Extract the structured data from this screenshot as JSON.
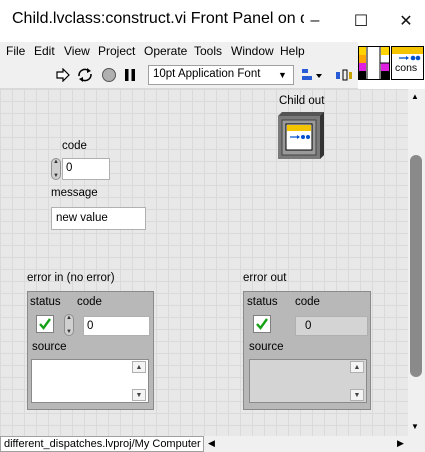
{
  "window": {
    "title": "Child.lvclass:construct.vi Front Panel on di···",
    "minimize": "–",
    "maximize": "☐",
    "close": "✕"
  },
  "menu": [
    "File",
    "Edit",
    "View",
    "Project",
    "Operate",
    "Tools",
    "Window",
    "Help"
  ],
  "toolbar": {
    "font": "10pt Application Font"
  },
  "icon": {
    "label": "cons"
  },
  "controls": {
    "child_out_label": "Child out",
    "code_label": "code",
    "code_value": "0",
    "message_label": "message",
    "message_value": "new value",
    "error_in": {
      "label": "error in (no error)",
      "status_label": "status",
      "code_label": "code",
      "code_value": "0",
      "source_label": "source"
    },
    "error_out": {
      "label": "error out",
      "status_label": "status",
      "code_label": "code",
      "code_value": "0",
      "source_label": "source"
    }
  },
  "status_bar": {
    "path": "different_dispatches.lvproj/My Computer"
  }
}
